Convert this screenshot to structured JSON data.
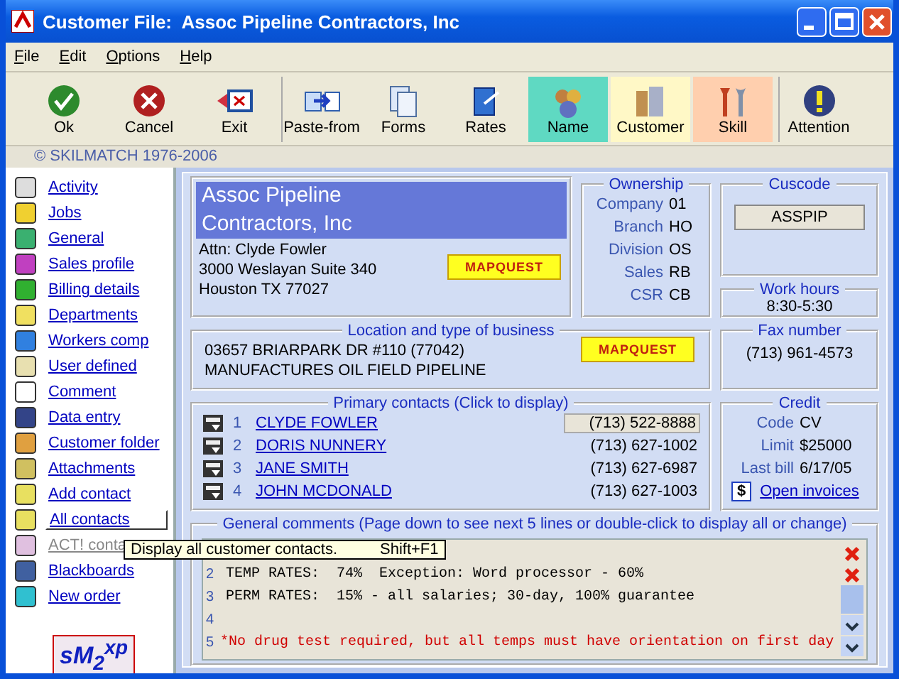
{
  "window": {
    "title": "Customer File:  Assoc Pipeline Contractors, Inc"
  },
  "menu": [
    "File",
    "Edit",
    "Options",
    "Help"
  ],
  "toolbar": [
    {
      "label": "Ok"
    },
    {
      "label": "Cancel"
    },
    {
      "label": "Exit"
    },
    {
      "label": "Paste-from"
    },
    {
      "label": "Forms"
    },
    {
      "label": "Rates"
    },
    {
      "label": "Name",
      "color": "#5fd9c2"
    },
    {
      "label": "Customer",
      "color": "#fff8c6"
    },
    {
      "label": "Skill",
      "color": "#ffcfae"
    },
    {
      "label": "Attention"
    }
  ],
  "copyright": "© SKILMATCH 1976-2006",
  "sidebar": {
    "items": [
      {
        "label": "Activity",
        "selected": false,
        "disabled": false
      },
      {
        "label": "Jobs",
        "selected": false,
        "disabled": false
      },
      {
        "label": "General",
        "selected": false,
        "disabled": false
      },
      {
        "label": "Sales profile",
        "selected": false,
        "disabled": false
      },
      {
        "label": "Billing details",
        "selected": false,
        "disabled": false
      },
      {
        "label": "Departments",
        "selected": false,
        "disabled": false
      },
      {
        "label": "Workers comp",
        "selected": false,
        "disabled": false
      },
      {
        "label": "User defined",
        "selected": false,
        "disabled": false
      },
      {
        "label": "Comment",
        "selected": false,
        "disabled": false
      },
      {
        "label": "Data entry",
        "selected": false,
        "disabled": false
      },
      {
        "label": "Customer folder",
        "selected": false,
        "disabled": false
      },
      {
        "label": "Attachments",
        "selected": false,
        "disabled": false
      },
      {
        "label": "Add contact",
        "selected": false,
        "disabled": false
      },
      {
        "label": "All contacts",
        "selected": true,
        "disabled": false
      },
      {
        "label": "ACT! conta",
        "selected": false,
        "disabled": true
      },
      {
        "label": "Blackboards",
        "selected": false,
        "disabled": false
      },
      {
        "label": "New order",
        "selected": false,
        "disabled": false
      }
    ],
    "logo": "sM$_{2}$$^{xp}$"
  },
  "company": {
    "name": "Assoc Pipeline Contractors, Inc",
    "lines": [
      "Attn: Clyde Fowler",
      "3000 Weslayan Suite 340",
      "Houston TX 77027"
    ],
    "map_button": "MAPQUEST"
  },
  "ownership": {
    "title": "Ownership",
    "rows": [
      {
        "label": "Company",
        "value": "01"
      },
      {
        "label": "Branch",
        "value": "HO"
      },
      {
        "label": "Division",
        "value": "OS"
      },
      {
        "label": "Sales",
        "value": "RB"
      },
      {
        "label": "CSR",
        "value": "CB"
      }
    ]
  },
  "cuscode": {
    "title": "Cuscode",
    "value": "ASSPIP"
  },
  "work_hours": {
    "title": "Work hours",
    "value": "8:30-5:30"
  },
  "location": {
    "title": "Location and type of business",
    "lines": [
      "03657 BRIARPARK DR #110 (77042)",
      "MANUFACTURES OIL FIELD PIPELINE"
    ],
    "map_button": "MAPQUEST"
  },
  "fax": {
    "title": "Fax number",
    "value": "(713) 961-4573"
  },
  "contacts": {
    "title": "Primary contacts (Click to display)",
    "rows": [
      {
        "number": "1",
        "name": "CLYDE FOWLER",
        "phone": "(713) 522-8888",
        "selected": true
      },
      {
        "number": "2",
        "name": "DORIS NUNNERY",
        "phone": "(713) 627-1002",
        "selected": false
      },
      {
        "number": "3",
        "name": "JANE SMITH",
        "phone": "(713) 627-6987",
        "selected": false
      },
      {
        "number": "4",
        "name": "JOHN MCDONALD",
        "phone": "(713) 627-1003",
        "selected": false
      }
    ]
  },
  "credit": {
    "title": "Credit",
    "rows": [
      {
        "label": "Code",
        "value": "CV"
      },
      {
        "label": "Limit",
        "value": "$25000"
      },
      {
        "label": "Last bill",
        "value": "6/17/05"
      }
    ],
    "invoice_icon": "$",
    "invoice_link": "Open invoices"
  },
  "comments": {
    "title": "General comments (Page down to see next 5 lines or double-click to display all or change)",
    "lines": [
      {
        "number": "2",
        "text": "TEMP RATES:  74%  Exception: Word processor - 60%",
        "kind": "normal"
      },
      {
        "number": "3",
        "text": "PERM RATES:  15% - all salaries; 30-day, 100% guarantee",
        "kind": "normal"
      },
      {
        "number": "4"
      },
      {
        "number": "5",
        "text": "*No drug test required, but all temps must have orientation on first day",
        "kind": "alert"
      }
    ]
  },
  "tooltip": {
    "text": "Display all customer contacts.",
    "shortcut": "Shift+F1"
  }
}
